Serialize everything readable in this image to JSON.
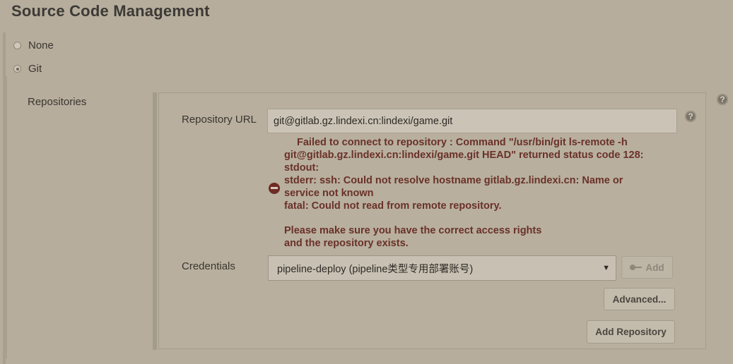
{
  "section": {
    "title": "Source Code Management"
  },
  "scm_options": [
    {
      "label": "None",
      "selected": false
    },
    {
      "label": "Git",
      "selected": true
    }
  ],
  "repositories": {
    "label": "Repositories",
    "url_label": "Repository URL",
    "url_value": "git@gitlab.gz.lindexi.cn:lindexi/game.git",
    "error_lines": [
      "Failed to connect to repository : Command \"/usr/bin/git ls-remote -h",
      "git@gitlab.gz.lindexi.cn:lindexi/game.git HEAD\" returned status code 128:",
      "stdout:",
      "stderr: ssh: Could not resolve hostname gitlab.gz.lindexi.cn: Name or",
      "service not known",
      "fatal: Could not read from remote repository.",
      "Please make sure you have the correct access rights",
      "and the repository exists."
    ],
    "credentials_label": "Credentials",
    "credentials_selected": "pipeline-deploy (pipeline类型专用部署账号)",
    "add_label": "Add",
    "advanced_label": "Advanced...",
    "add_repository_label": "Add Repository",
    "help_glyph": "?"
  },
  "colors": {
    "background": "#b6ad9c",
    "error_text": "#6a3128",
    "error_icon": "#6e2b24"
  },
  "icons": {
    "help": "help-circle-icon",
    "error": "error-minus-circle-icon",
    "key": "key-icon",
    "dropdown": "chevron-down-icon"
  }
}
